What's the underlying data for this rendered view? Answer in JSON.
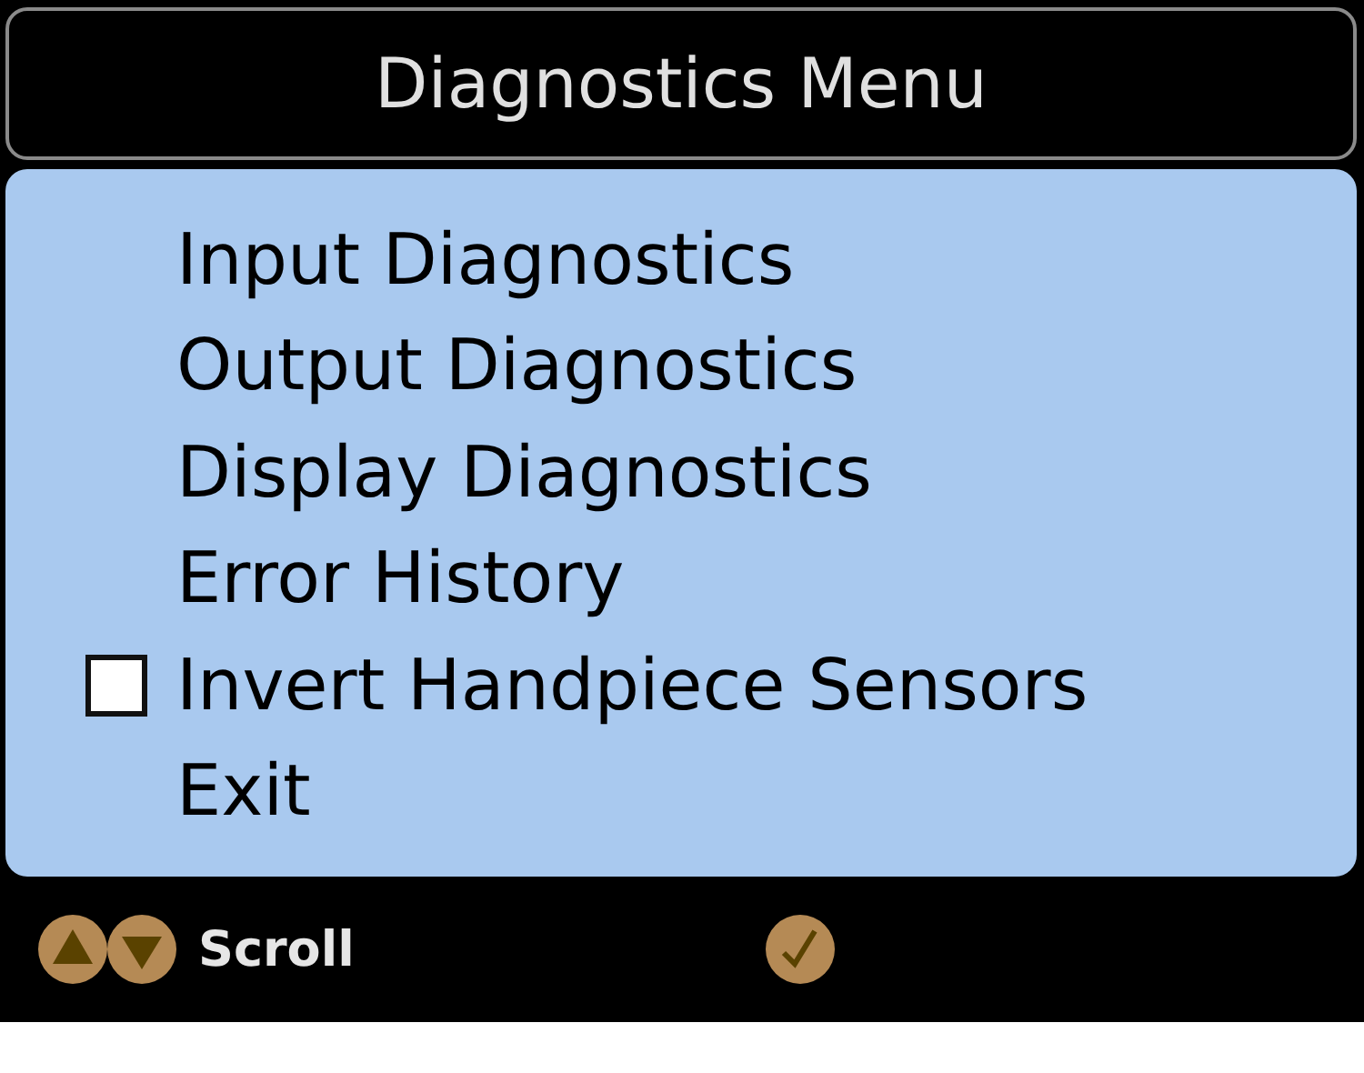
{
  "header": {
    "title": "Diagnostics Menu"
  },
  "menu": {
    "items": [
      {
        "kind": "text",
        "label": "Input Diagnostics"
      },
      {
        "kind": "text",
        "label": "Output Diagnostics"
      },
      {
        "kind": "text",
        "label": "Display Diagnostics"
      },
      {
        "kind": "text",
        "label": "Error History"
      },
      {
        "kind": "checkbox",
        "label": "Invert Handpiece Sensors",
        "checked": false
      },
      {
        "kind": "text",
        "label": "Exit"
      }
    ]
  },
  "footer": {
    "scroll_label": "Scroll"
  }
}
